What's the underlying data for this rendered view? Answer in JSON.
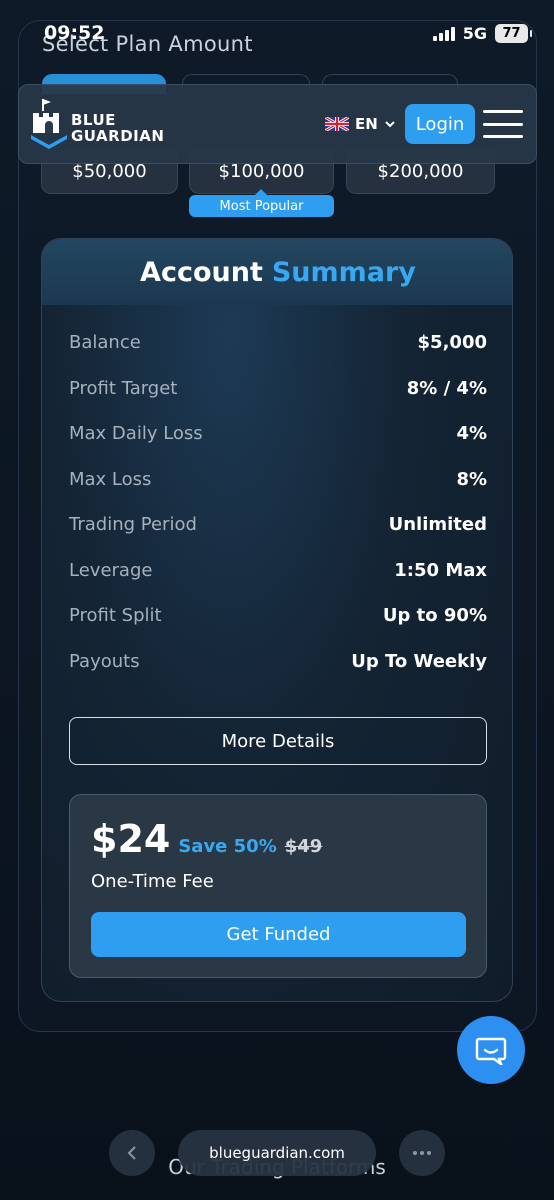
{
  "status_bar": {
    "time": "09:52",
    "network": "5G",
    "battery": "77"
  },
  "plans_section": {
    "title": "Select Plan Amount",
    "plans": [
      "$50,000",
      "$100,000",
      "$200,000"
    ],
    "popular_badge": "Most Popular"
  },
  "header": {
    "brand_line1": "BLUE",
    "brand_line2": "GUARDIAN",
    "language": "EN",
    "login_label": "Login"
  },
  "summary": {
    "title_main": "Account",
    "title_accent": "Summary",
    "rows": [
      {
        "label": "Balance",
        "value": "$5,000"
      },
      {
        "label": "Profit Target",
        "value": "8% / 4%"
      },
      {
        "label": "Max Daily Loss",
        "value": "4%"
      },
      {
        "label": "Max Loss",
        "value": "8%"
      },
      {
        "label": "Trading Period",
        "value": "Unlimited"
      },
      {
        "label": "Leverage",
        "value": "1:50 Max"
      },
      {
        "label": "Profit Split",
        "value": "Up to 90%"
      },
      {
        "label": "Payouts",
        "value": "Up To Weekly"
      }
    ],
    "more_details_label": "More Details"
  },
  "pricing": {
    "price": "$24",
    "save_text": "Save 50%",
    "old_price": "$49",
    "fee_label": "One-Time Fee",
    "cta_label": "Get Funded"
  },
  "browser": {
    "url": "blueguardian.com",
    "bottom_heading": "Our Trading Platforms"
  },
  "colors": {
    "accent": "#2d9ef0",
    "background": "#0b1420",
    "card": "#142434"
  }
}
